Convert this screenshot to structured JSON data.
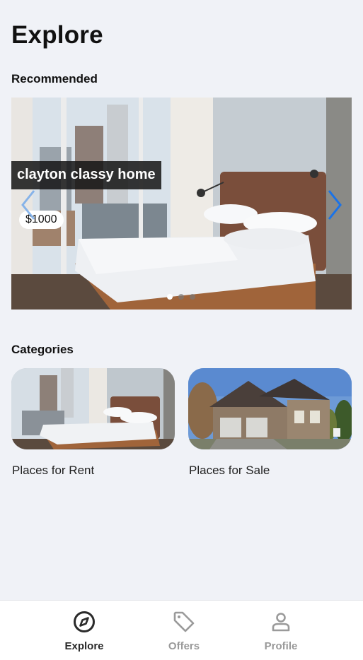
{
  "header": {
    "title": "Explore"
  },
  "recommended": {
    "section_title": "Recommended",
    "slides": [
      {
        "title": "clayton classy home",
        "price": "$1000"
      }
    ],
    "slide_count": 3,
    "active_slide": 1,
    "arrow_color": "#1a73e8"
  },
  "categories": {
    "section_title": "Categories",
    "items": [
      {
        "label": "Places for Rent"
      },
      {
        "label": "Places for Sale"
      }
    ]
  },
  "bottom_nav": {
    "items": [
      {
        "label": "Explore",
        "icon": "compass-icon",
        "active": true
      },
      {
        "label": "Offers",
        "icon": "tag-icon",
        "active": false
      },
      {
        "label": "Profile",
        "icon": "person-icon",
        "active": false
      }
    ]
  }
}
